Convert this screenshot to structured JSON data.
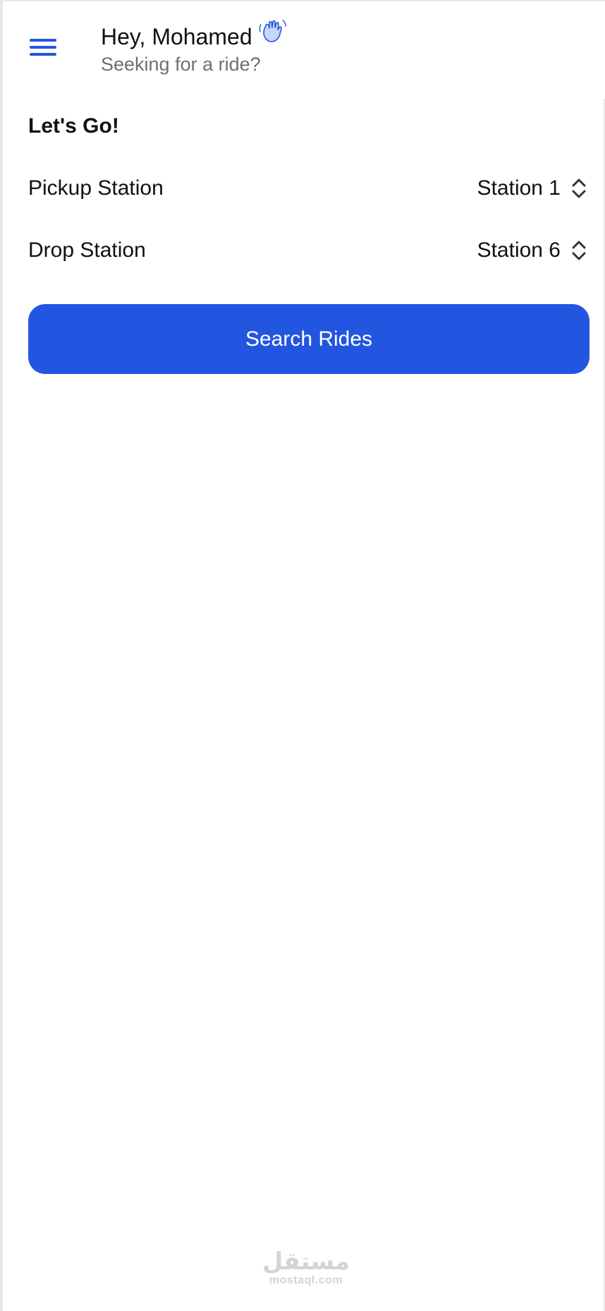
{
  "header": {
    "greeting": "Hey, Mohamed",
    "subtitle": "Seeking for a ride?",
    "menu_icon": "hamburger-menu-icon",
    "wave_icon": "waving-hand-icon"
  },
  "form": {
    "title": "Let's Go!",
    "pickup": {
      "label": "Pickup Station",
      "value": "Station 1"
    },
    "drop": {
      "label": "Drop Station",
      "value": "Station 6"
    },
    "search_label": "Search Rides"
  },
  "watermark": {
    "arabic": "مستقل",
    "latin": "mostaql.com"
  },
  "colors": {
    "accent": "#2356e0",
    "text": "#111111",
    "muted": "#6f6f6f",
    "background": "#ffffff"
  }
}
